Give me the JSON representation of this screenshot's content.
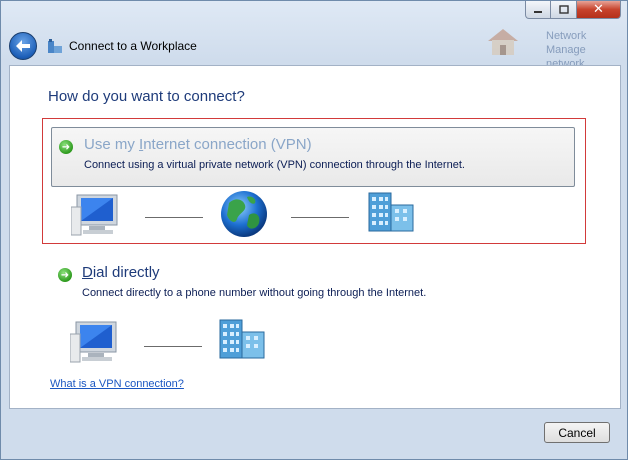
{
  "window": {
    "title": "Connect to a Workplace",
    "close_glyph": "✕"
  },
  "background_ghost": {
    "line1": "Network",
    "line2": "Manage network"
  },
  "main": {
    "heading": "How do you want to connect?",
    "options": [
      {
        "title_prefix": "Use my ",
        "title_accel": "I",
        "title_suffix": "nternet connection (VPN)",
        "description": "Connect using a virtual private network (VPN) connection through the Internet.",
        "icons": [
          "computer-icon",
          "globe-icon",
          "building-icon"
        ]
      },
      {
        "title_prefix": "",
        "title_accel": "D",
        "title_suffix": "ial directly",
        "description": "Connect directly to a phone number without going through the Internet.",
        "icons": [
          "computer-icon",
          "building-icon"
        ]
      }
    ],
    "help_link": "What is a VPN connection?"
  },
  "footer": {
    "cancel_label": "Cancel"
  },
  "colors": {
    "heading": "#1e3b7a",
    "highlight_border": "#d23a3a",
    "link": "#1b57c2"
  }
}
